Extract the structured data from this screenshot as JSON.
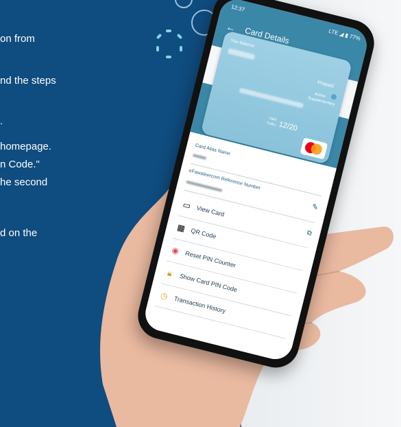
{
  "instructions": [
    "on from",
    "nd the steps",
    ".",
    " homepage.",
    "n Code.\"",
    "he second",
    "d on the"
  ],
  "phone": {
    "status_time": "12:37",
    "status_right": "LTE ◢ ▮ 77%",
    "header_title": "Card Details",
    "card": {
      "balance_label": "Your Balance",
      "type": "Prepaid",
      "status_active": "Active",
      "status_supplementary": "Supplementary",
      "valid_label": "Valid",
      "thru_label": "THRU",
      "expiry": "12/20"
    },
    "fields": [
      {
        "label": "Card Alias Name"
      },
      {
        "label": "eFawateercom Reference Number"
      }
    ],
    "menu": [
      {
        "label": "View Card",
        "icon": "card-icon"
      },
      {
        "label": "QR Code",
        "icon": "qr-code-icon"
      },
      {
        "label": "Reset PIN Counter",
        "icon": "reset-icon"
      },
      {
        "label": "Show Card PIN Code",
        "icon": "lock-icon"
      },
      {
        "label": "Transaction History",
        "icon": "clock-icon"
      }
    ]
  },
  "colors": {
    "left_panel": "#0f4c7f",
    "accent": "#3b87a8",
    "card": "#89c2da",
    "text_primary": "#1f3a52"
  }
}
